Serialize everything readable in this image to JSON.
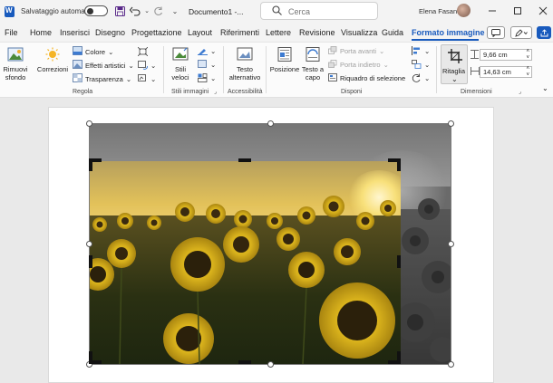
{
  "titlebar": {
    "autosave_label": "Salvataggio automatico",
    "doc_title": "Documento1 -...",
    "search_placeholder": "Cerca",
    "user_name": "Elena Fasano"
  },
  "tabs": [
    "File",
    "Home",
    "Inserisci",
    "Disegno",
    "Progettazione",
    "Layout",
    "Riferimenti",
    "Lettere",
    "Revisione",
    "Visualizza",
    "Guida",
    "Formato immagine"
  ],
  "tab_tools": {
    "comment_button": "⎘"
  },
  "ribbon": {
    "regola": {
      "label": "Regola",
      "remove_background": "Rimuovi sfondo",
      "corrections": "Correzioni",
      "color": "Colore",
      "artistic_effects": "Effetti artistici",
      "transparency": "Trasparenza"
    },
    "stili": {
      "label": "Stili immagini",
      "quick_styles": "Stili veloci"
    },
    "accessibilita": {
      "label": "Accessibilità",
      "alt_text": "Testo alternativo"
    },
    "disponi": {
      "label": "Disponi",
      "position": "Posizione",
      "wrap_text": "Testo a capo",
      "bring_forward": "Porta avanti",
      "send_backward": "Porta indietro",
      "selection_pane": "Riquadro di selezione"
    },
    "dimensioni": {
      "label": "Dimensioni",
      "crop": "Ritaglia",
      "height": "9,66 cm",
      "width": "14,63 cm"
    }
  },
  "image": {
    "subject": "sunflower field at sunset"
  },
  "colors": {
    "accent": "#185abd",
    "ribbon_bg": "#fbfbfb",
    "canvas_bg": "#e9e9e9"
  }
}
